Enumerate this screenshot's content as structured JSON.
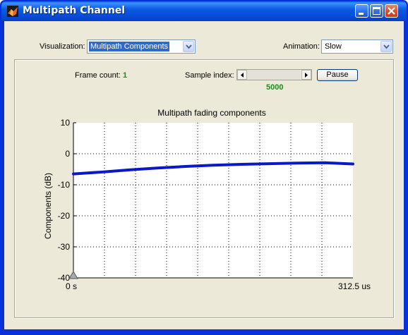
{
  "window": {
    "title": "Multipath Channel"
  },
  "controls": {
    "visualization_label": "Visualization:",
    "visualization_value": "Multipath Components",
    "animation_label": "Animation:",
    "animation_value": "Slow",
    "frame_count_label": "Frame count:",
    "frame_count_value": "1",
    "sample_index_label": "Sample index:",
    "sample_index_value": "5000",
    "pause_label": "Pause"
  },
  "colors": {
    "accent_green": "#1f8a1f",
    "series_blue": "#0a18c8",
    "title_blue": "#0a5fe8"
  },
  "icons": [
    "matlab-logo-icon",
    "minimize-icon",
    "maximize-icon",
    "close-icon",
    "chevron-down-icon",
    "arrow-left-icon",
    "arrow-right-icon",
    "triangle-marker-icon"
  ],
  "chart_data": {
    "type": "line",
    "title": "Multipath fading components",
    "xlabel": "",
    "ylabel": "Components (dB)",
    "x_tick_labels": [
      "0 s",
      "312.5 us"
    ],
    "y_tick_labels": [
      "10",
      "0",
      "-10",
      "-20",
      "-30",
      "-40"
    ],
    "ylim": [
      -40,
      10
    ],
    "xlim": [
      0,
      312.5
    ],
    "x_unit": "us",
    "grid": true,
    "series": [
      {
        "x": [
          0,
          31.25,
          62.5,
          93.75,
          125,
          156.25,
          187.5,
          218.75,
          250,
          281.25,
          312.5
        ],
        "y": [
          -6.5,
          -5.9,
          -5.2,
          -4.6,
          -4.1,
          -3.7,
          -3.4,
          -3.2,
          -3.0,
          -2.9,
          -3.3
        ]
      }
    ]
  }
}
